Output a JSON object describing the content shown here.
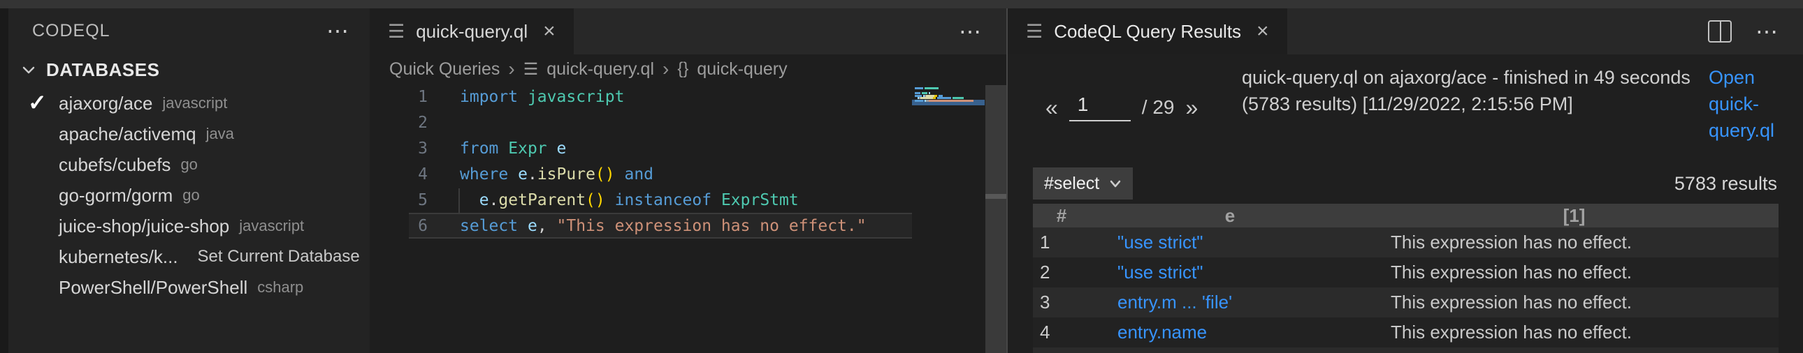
{
  "icons": {
    "more": "⋯",
    "list": "☰",
    "close": "×",
    "check": "✓",
    "chevron_right": "›",
    "braces": "{}",
    "prev": "«",
    "next": "»"
  },
  "sidebar": {
    "title": "CODEQL",
    "section": "DATABASES",
    "databases": [
      {
        "name": "ajaxorg/ace",
        "lang": "javascript",
        "selected": true
      },
      {
        "name": "apache/activemq",
        "lang": "java"
      },
      {
        "name": "cubefs/cubefs",
        "lang": "go"
      },
      {
        "name": "go-gorm/gorm",
        "lang": "go"
      },
      {
        "name": "juice-shop/juice-shop",
        "lang": "javascript"
      },
      {
        "name": "kubernetes/k...",
        "lang": "",
        "action": "Set Current Database"
      },
      {
        "name": "PowerShell/PowerShell",
        "lang": "csharp"
      }
    ]
  },
  "editor": {
    "tab_label": "quick-query.ql",
    "breadcrumb": {
      "root": "Quick Queries",
      "file": "quick-query.ql",
      "symbol": "quick-query"
    },
    "code_lines": [
      {
        "tokens": [
          [
            "import",
            "kw"
          ],
          [
            " ",
            "ws"
          ],
          [
            "javascript",
            "ty"
          ]
        ]
      },
      {
        "tokens": []
      },
      {
        "tokens": [
          [
            "from",
            "kw"
          ],
          [
            " ",
            "ws"
          ],
          [
            "Expr",
            "ty"
          ],
          [
            " ",
            "ws"
          ],
          [
            "e",
            "vr"
          ]
        ]
      },
      {
        "tokens": [
          [
            "where",
            "kw"
          ],
          [
            " ",
            "ws"
          ],
          [
            "e",
            "vr"
          ],
          [
            ".",
            "pn"
          ],
          [
            "isPure",
            "fn"
          ],
          [
            "()",
            "br"
          ],
          [
            " ",
            "ws"
          ],
          [
            "and",
            "kw"
          ]
        ]
      },
      {
        "tokens": [
          [
            "  ",
            "ws"
          ],
          [
            "e",
            "vr"
          ],
          [
            ".",
            "pn"
          ],
          [
            "getParent",
            "fn"
          ],
          [
            "()",
            "br"
          ],
          [
            " ",
            "ws"
          ],
          [
            "instanceof",
            "kw"
          ],
          [
            " ",
            "ws"
          ],
          [
            "ExprStmt",
            "ty"
          ]
        ]
      },
      {
        "tokens": [
          [
            "select",
            "kw"
          ],
          [
            " ",
            "ws"
          ],
          [
            "e",
            "vr"
          ],
          [
            ", ",
            "pn"
          ],
          [
            "\"This expression has no effect.\"",
            "st"
          ]
        ],
        "current": true
      }
    ]
  },
  "results": {
    "tab_label": "CodeQL Query Results",
    "pagination": {
      "page": "1",
      "total": "/ 29"
    },
    "summary": "quick-query.ql on ajaxorg/ace - finished in 49 seconds (5783 results) [11/29/2022, 2:15:56 PM]",
    "open_link": "Open quick-query.ql",
    "select_label": "#select",
    "count": "5783 results",
    "table": {
      "columns": [
        "#",
        "e",
        "[1]"
      ],
      "rows": [
        [
          "1",
          "\"use strict\"",
          "This expression has no effect."
        ],
        [
          "2",
          "\"use strict\"",
          "This expression has no effect."
        ],
        [
          "3",
          "entry.m ... 'file'",
          "This expression has no effect."
        ],
        [
          "4",
          "entry.name",
          "This expression has no effect."
        ]
      ]
    }
  }
}
